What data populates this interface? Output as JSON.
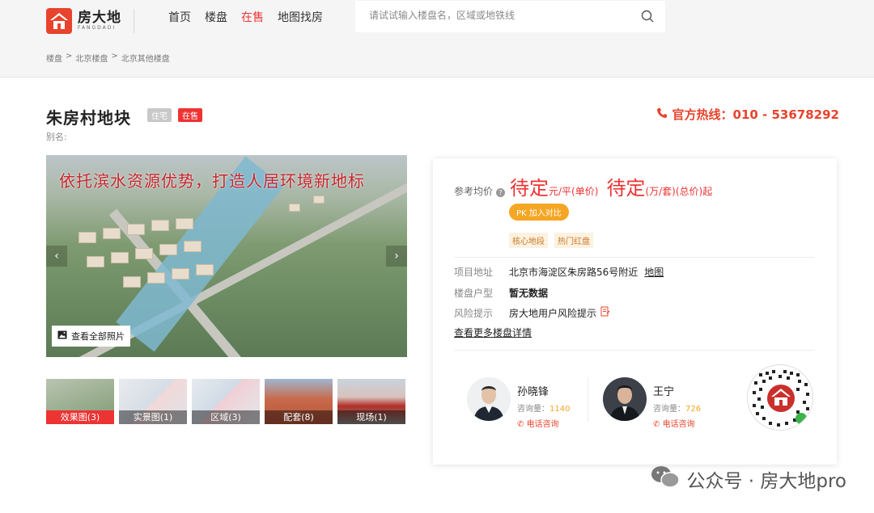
{
  "header": {
    "logo_cn": "房大地",
    "logo_en": "FANGDADI",
    "nav": [
      "首页",
      "楼盘",
      "在售",
      "地图找房"
    ],
    "nav_active_index": 2,
    "search_placeholder": "请试试输入楼盘名，区域或地铁线"
  },
  "breadcrumb": [
    "楼盘",
    "北京楼盘",
    "北京其他楼盘"
  ],
  "breadcrumb_sep": ">",
  "project": {
    "title": "朱房村地块",
    "tag_type": "住宅",
    "tag_status": "在售",
    "alias_label": "别名:",
    "hotline": "官方热线：010 - 53678292"
  },
  "gallery": {
    "headline": "依托滨水资源优势，打造人居环境新地标",
    "view_all": "查看全部照片",
    "thumbs": [
      "效果图(3)",
      "实景图(1)",
      "区域(3)",
      "配套(8)",
      "现场(1)"
    ]
  },
  "price": {
    "label": "参考均价",
    "unit_value": "待定",
    "unit_suffix": "元/平(单价)",
    "total_value": "待定",
    "total_suffix": "(万/套)(总价)起",
    "pk_label": "PK 加入对比",
    "tags": [
      "核心地段",
      "热门红盘"
    ]
  },
  "info": {
    "address_key": "项目地址",
    "address_val": "北京市海淀区朱房路56号附近",
    "map_link": "地图",
    "layout_key": "楼盘户型",
    "layout_val": "暂无数据",
    "risk_key": "风险提示",
    "risk_val": "房大地用户风险提示",
    "more_link": "查看更多楼盘详情"
  },
  "agents": [
    {
      "name": "孙晓锋",
      "count_label": "咨询量：",
      "count": "1140",
      "call": "电话咨询"
    },
    {
      "name": "王宁",
      "count_label": "咨询量：",
      "count": "726",
      "call": "电话咨询"
    }
  ],
  "watermark": "公众号 · 房大地pro",
  "colors": {
    "accent": "#e8432c",
    "orange": "#f5a623"
  }
}
